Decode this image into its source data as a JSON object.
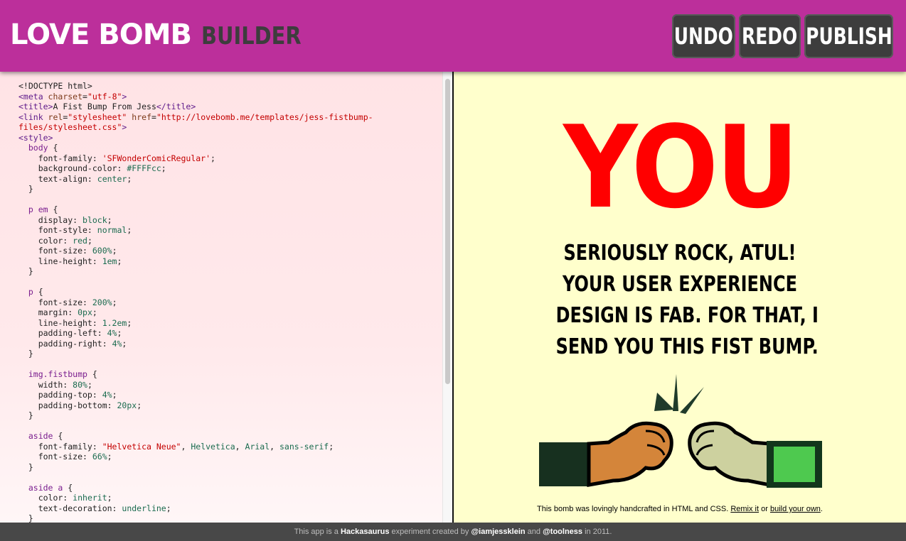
{
  "header": {
    "logo_main": "LOVE BOMB",
    "logo_sub": "BUILDER",
    "bg_color": "#bc2f9b",
    "buttons": {
      "undo": "UNDO",
      "redo": "REDO",
      "publish": "PUBLISH"
    }
  },
  "editor": {
    "lines": [
      [
        [
          "pu",
          "<!DOCTYPE html>"
        ]
      ],
      [
        [
          "tg",
          "<meta "
        ],
        [
          "at",
          "charset"
        ],
        [
          "pu",
          "="
        ],
        [
          "st",
          "\"utf-8\""
        ],
        [
          "tg",
          ">"
        ]
      ],
      [
        [
          "tg",
          "<title>"
        ],
        [
          "pu",
          "A Fist Bump From Jess"
        ],
        [
          "tg",
          "</title>"
        ]
      ],
      [
        [
          "tg",
          "<link "
        ],
        [
          "at",
          "rel"
        ],
        [
          "pu",
          "="
        ],
        [
          "st",
          "\"stylesheet\""
        ],
        [
          "pu",
          " "
        ],
        [
          "at",
          "href"
        ],
        [
          "pu",
          "="
        ],
        [
          "st",
          "\"http://lovebomb.me/templates/jess-fistbump-"
        ]
      ],
      [
        [
          "st",
          "files/stylesheet.css\""
        ],
        [
          "tg",
          ">"
        ]
      ],
      [
        [
          "tg",
          "<style>"
        ]
      ],
      [
        [
          "sel",
          "  body "
        ],
        [
          "pu",
          "{"
        ]
      ],
      [
        [
          "pr",
          "    font-family: "
        ],
        [
          "st",
          "'SFWonderComicRegular'"
        ],
        [
          "pu",
          ";"
        ]
      ],
      [
        [
          "pr",
          "    background-color: "
        ],
        [
          "nm",
          "#FFFFcc"
        ],
        [
          "pu",
          ";"
        ]
      ],
      [
        [
          "pr",
          "    text-align: "
        ],
        [
          "vl",
          "center"
        ],
        [
          "pu",
          ";"
        ]
      ],
      [
        [
          "pu",
          "  }"
        ]
      ],
      [
        [
          "pu",
          ""
        ]
      ],
      [
        [
          "sel",
          "  p em "
        ],
        [
          "pu",
          "{"
        ]
      ],
      [
        [
          "pr",
          "    display: "
        ],
        [
          "vl",
          "block"
        ],
        [
          "pu",
          ";"
        ]
      ],
      [
        [
          "pr",
          "    font-style: "
        ],
        [
          "vl",
          "normal"
        ],
        [
          "pu",
          ";"
        ]
      ],
      [
        [
          "pr",
          "    color: "
        ],
        [
          "vl",
          "red"
        ],
        [
          "pu",
          ";"
        ]
      ],
      [
        [
          "pr",
          "    font-size: "
        ],
        [
          "nm",
          "600%"
        ],
        [
          "pu",
          ";"
        ]
      ],
      [
        [
          "pr",
          "    line-height: "
        ],
        [
          "nm",
          "1em"
        ],
        [
          "pu",
          ";"
        ]
      ],
      [
        [
          "pu",
          "  }"
        ]
      ],
      [
        [
          "pu",
          ""
        ]
      ],
      [
        [
          "sel",
          "  p "
        ],
        [
          "pu",
          "{"
        ]
      ],
      [
        [
          "pr",
          "    font-size: "
        ],
        [
          "nm",
          "200%"
        ],
        [
          "pu",
          ";"
        ]
      ],
      [
        [
          "pr",
          "    margin: "
        ],
        [
          "nm",
          "0px"
        ],
        [
          "pu",
          ";"
        ]
      ],
      [
        [
          "pr",
          "    line-height: "
        ],
        [
          "nm",
          "1.2em"
        ],
        [
          "pu",
          ";"
        ]
      ],
      [
        [
          "pr",
          "    padding-left: "
        ],
        [
          "nm",
          "4%"
        ],
        [
          "pu",
          ";"
        ]
      ],
      [
        [
          "pr",
          "    padding-right: "
        ],
        [
          "nm",
          "4%"
        ],
        [
          "pu",
          ";"
        ]
      ],
      [
        [
          "pu",
          "  }"
        ]
      ],
      [
        [
          "pu",
          ""
        ]
      ],
      [
        [
          "sel",
          "  img.fistbump "
        ],
        [
          "pu",
          "{"
        ]
      ],
      [
        [
          "pr",
          "    width: "
        ],
        [
          "nm",
          "80%"
        ],
        [
          "pu",
          ";"
        ]
      ],
      [
        [
          "pr",
          "    padding-top: "
        ],
        [
          "nm",
          "4%"
        ],
        [
          "pu",
          ";"
        ]
      ],
      [
        [
          "pr",
          "    padding-bottom: "
        ],
        [
          "nm",
          "20px"
        ],
        [
          "pu",
          ";"
        ]
      ],
      [
        [
          "pu",
          "  }"
        ]
      ],
      [
        [
          "pu",
          ""
        ]
      ],
      [
        [
          "sel",
          "  aside "
        ],
        [
          "pu",
          "{"
        ]
      ],
      [
        [
          "pr",
          "    font-family: "
        ],
        [
          "st",
          "\"Helvetica Neue\""
        ],
        [
          "pu",
          ", "
        ],
        [
          "vl",
          "Helvetica"
        ],
        [
          "pu",
          ", "
        ],
        [
          "vl",
          "Arial"
        ],
        [
          "pu",
          ", "
        ],
        [
          "vl",
          "sans-serif"
        ],
        [
          "pu",
          ";"
        ]
      ],
      [
        [
          "pr",
          "    font-size: "
        ],
        [
          "nm",
          "66%"
        ],
        [
          "pu",
          ";"
        ]
      ],
      [
        [
          "pu",
          "  }"
        ]
      ],
      [
        [
          "pu",
          ""
        ]
      ],
      [
        [
          "sel",
          "  aside a "
        ],
        [
          "pu",
          "{"
        ]
      ],
      [
        [
          "pr",
          "    color: "
        ],
        [
          "vl",
          "inherit"
        ],
        [
          "pu",
          ";"
        ]
      ],
      [
        [
          "pr",
          "    text-decoration: "
        ],
        [
          "vl",
          "underline"
        ],
        [
          "pu",
          ";"
        ]
      ],
      [
        [
          "pu",
          "  }"
        ]
      ]
    ]
  },
  "preview": {
    "bg_color": "#ffffcc",
    "em_text": "YOU",
    "em_color": "#ff0000",
    "message_lines": [
      "Seriously rock, Atul!",
      "Your user experience",
      "design is fab. For that, I",
      "send you this fist bump."
    ],
    "credit": {
      "before": "This bomb was lovingly handcrafted in HTML and CSS. ",
      "remix_link": "Remix it",
      "middle": " or ",
      "build_link": "build your own",
      "after": "."
    }
  },
  "footer": {
    "t1": "This app is a ",
    "hackasaurus": "Hackasaurus",
    "t2": " experiment created by ",
    "author1": "@iamjessklein",
    "t3": " and ",
    "author2": "@toolness",
    "t4": " in 2011."
  }
}
